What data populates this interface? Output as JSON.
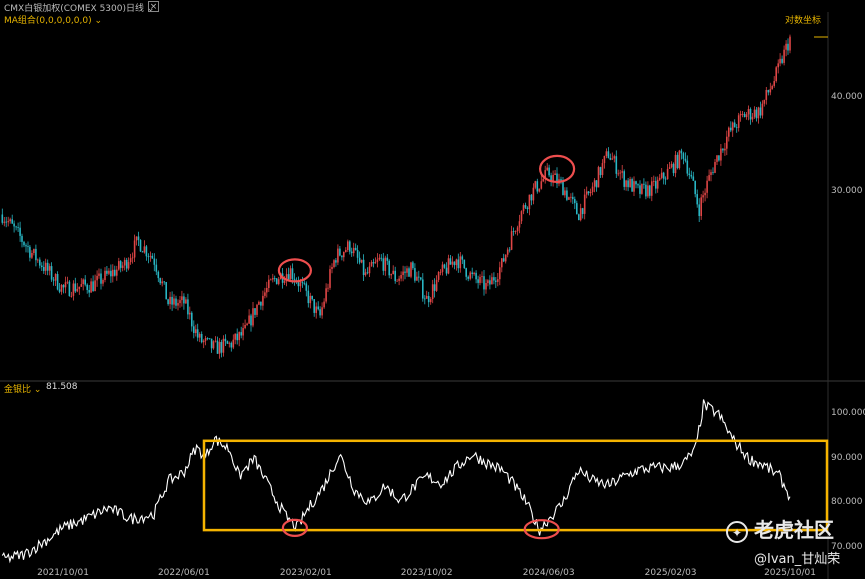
{
  "header": {
    "symbol": "CMX白银加权(COMEX 5300)",
    "period": "日线",
    "period_icon": "chevron-down-icon",
    "ma_label": "MA组合(0,0,0,0,0,0)",
    "ma_icon": "chevron-down-icon",
    "close_icon": "close-icon",
    "log_badge": "对数坐标"
  },
  "indicator": {
    "name": "金银比",
    "icon": "chevron-down-icon",
    "value": "81.508"
  },
  "colors": {
    "background": "#000000",
    "up_candle": "#e04646",
    "down_candle": "#29b6c4",
    "ratio_line": "#ffffff",
    "band": "#f5b400",
    "circle": "#ee4e4e",
    "accent": "#e5b300"
  },
  "watermark": {
    "brand": "老虎社区",
    "user": "@Ivan_甘灿荣",
    "icon": "tiger-logo-icon"
  },
  "chart_data": [
    {
      "type": "line",
      "subtype": "candlestick",
      "scale": "log",
      "x": [
        "2021/10/01",
        "2022/06/01",
        "2023/02/01",
        "2023/10/02",
        "2024/06/03",
        "2025/02/03",
        "2025/10/01"
      ],
      "y_ticks": [
        30.0,
        40.0
      ],
      "y_tick_labels": [
        "30.000",
        "40.000"
      ],
      "series": [
        {
          "values": [
            [
              "2021/06/01",
              28.0
            ],
            [
              "2021/08/01",
              24.8
            ],
            [
              "2021/10/01",
              22.3
            ],
            [
              "2021/12/01",
              22.6
            ],
            [
              "2022/02/01",
              24.0
            ],
            [
              "2022/03/01",
              25.8
            ],
            [
              "2022/04/01",
              24.5
            ],
            [
              "2022/05/01",
              21.3
            ],
            [
              "2022/06/01",
              21.4
            ],
            [
              "2022/07/01",
              19.1
            ],
            [
              "2022/08/01",
              18.6
            ],
            [
              "2022/09/01",
              18.8
            ],
            [
              "2022/10/01",
              19.5
            ],
            [
              "2022/11/01",
              21.6
            ],
            [
              "2022/12/01",
              23.0
            ],
            [
              "2023/01/01",
              23.6
            ],
            [
              "2023/02/01",
              22.0
            ],
            [
              "2023/03/01",
              20.4
            ],
            [
              "2023/04/01",
              24.6
            ],
            [
              "2023/05/01",
              25.5
            ],
            [
              "2023/06/01",
              23.2
            ],
            [
              "2023/07/01",
              24.4
            ],
            [
              "2023/08/01",
              23.0
            ],
            [
              "2023/09/01",
              23.8
            ],
            [
              "2023/10/02",
              21.6
            ],
            [
              "2023/11/01",
              23.4
            ],
            [
              "2023/12/01",
              24.5
            ],
            [
              "2024/01/01",
              23.1
            ],
            [
              "2024/02/01",
              22.4
            ],
            [
              "2024/03/01",
              24.0
            ],
            [
              "2024/04/01",
              27.5
            ],
            [
              "2024/05/01",
              30.0
            ],
            [
              "2024/06/03",
              31.8
            ],
            [
              "2024/07/01",
              30.5
            ],
            [
              "2024/08/01",
              28.0
            ],
            [
              "2024/09/01",
              30.5
            ],
            [
              "2024/10/01",
              33.8
            ],
            [
              "2024/11/01",
              31.2
            ],
            [
              "2024/12/01",
              30.0
            ],
            [
              "2025/01/01",
              30.4
            ],
            [
              "2025/02/03",
              32.2
            ],
            [
              "2025/03/01",
              33.8
            ],
            [
              "2025/04/01",
              28.5
            ],
            [
              "2025/05/01",
              32.6
            ],
            [
              "2025/06/01",
              36.0
            ],
            [
              "2025/07/01",
              38.0
            ],
            [
              "2025/08/01",
              38.4
            ],
            [
              "2025/09/01",
              42.5
            ],
            [
              "2025/10/01",
              48.0
            ]
          ]
        }
      ]
    },
    {
      "type": "line",
      "title": "金银比",
      "last_value": 81.508,
      "x": [
        "2021/10/01",
        "2022/06/01",
        "2023/02/01",
        "2023/10/02",
        "2024/06/03",
        "2025/02/03",
        "2025/10/01"
      ],
      "y_ticks": [
        70.0,
        80.0,
        90.0,
        100.0
      ],
      "y_tick_labels": [
        "70.000",
        "80.000",
        "90.000",
        "100.000"
      ],
      "ylim": [
        69,
        103.5
      ],
      "band": [
        74,
        94
      ],
      "series": [
        {
          "values": [
            [
              "2021/06/01",
              67.5
            ],
            [
              "2021/07/15",
              68.5
            ],
            [
              "2021/09/01",
              72.0
            ],
            [
              "2021/10/01",
              74.5
            ],
            [
              "2021/11/15",
              76.5
            ],
            [
              "2022/01/01",
              79.0
            ],
            [
              "2022/02/15",
              76.5
            ],
            [
              "2022/04/01",
              77.5
            ],
            [
              "2022/05/01",
              85.0
            ],
            [
              "2022/06/01",
              87.0
            ],
            [
              "2022/06/25",
              92.5
            ],
            [
              "2022/07/15",
              90.5
            ],
            [
              "2022/08/01",
              94.5
            ],
            [
              "2022/09/01",
              92.0
            ],
            [
              "2022/09/20",
              86.0
            ],
            [
              "2022/10/20",
              90.0
            ],
            [
              "2022/11/20",
              83.5
            ],
            [
              "2022/12/20",
              77.5
            ],
            [
              "2023/01/01",
              76.0
            ],
            [
              "2023/01/15",
              74.5
            ],
            [
              "2023/02/01",
              78.0
            ],
            [
              "2023/03/10",
              84.0
            ],
            [
              "2023/04/10",
              91.0
            ],
            [
              "2023/05/10",
              83.0
            ],
            [
              "2023/06/10",
              80.0
            ],
            [
              "2023/07/10",
              84.0
            ],
            [
              "2023/08/10",
              80.5
            ],
            [
              "2023/09/10",
              84.0
            ],
            [
              "2023/10/02",
              86.0
            ],
            [
              "2023/11/01",
              84.5
            ],
            [
              "2023/12/01",
              88.0
            ],
            [
              "2024/01/01",
              91.0
            ],
            [
              "2024/02/01",
              89.0
            ],
            [
              "2024/03/01",
              87.5
            ],
            [
              "2024/03/20",
              85.0
            ],
            [
              "2024/04/20",
              80.0
            ],
            [
              "2024/05/15",
              74.0
            ],
            [
              "2024/06/03",
              76.5
            ],
            [
              "2024/07/01",
              80.0
            ],
            [
              "2024/08/01",
              87.5
            ],
            [
              "2024/09/01",
              85.0
            ],
            [
              "2024/10/01",
              84.0
            ],
            [
              "2024/11/01",
              86.0
            ],
            [
              "2024/12/01",
              87.5
            ],
            [
              "2025/01/01",
              88.0
            ],
            [
              "2025/02/03",
              88.0
            ],
            [
              "2025/03/01",
              89.0
            ],
            [
              "2025/03/25",
              92.0
            ],
            [
              "2025/04/10",
              102.0
            ],
            [
              "2025/05/10",
              100.0
            ],
            [
              "2025/06/10",
              94.0
            ],
            [
              "2025/07/10",
              90.0
            ],
            [
              "2025/08/10",
              88.5
            ],
            [
              "2025/09/10",
              86.0
            ],
            [
              "2025/10/01",
              81.5
            ]
          ]
        }
      ]
    }
  ]
}
